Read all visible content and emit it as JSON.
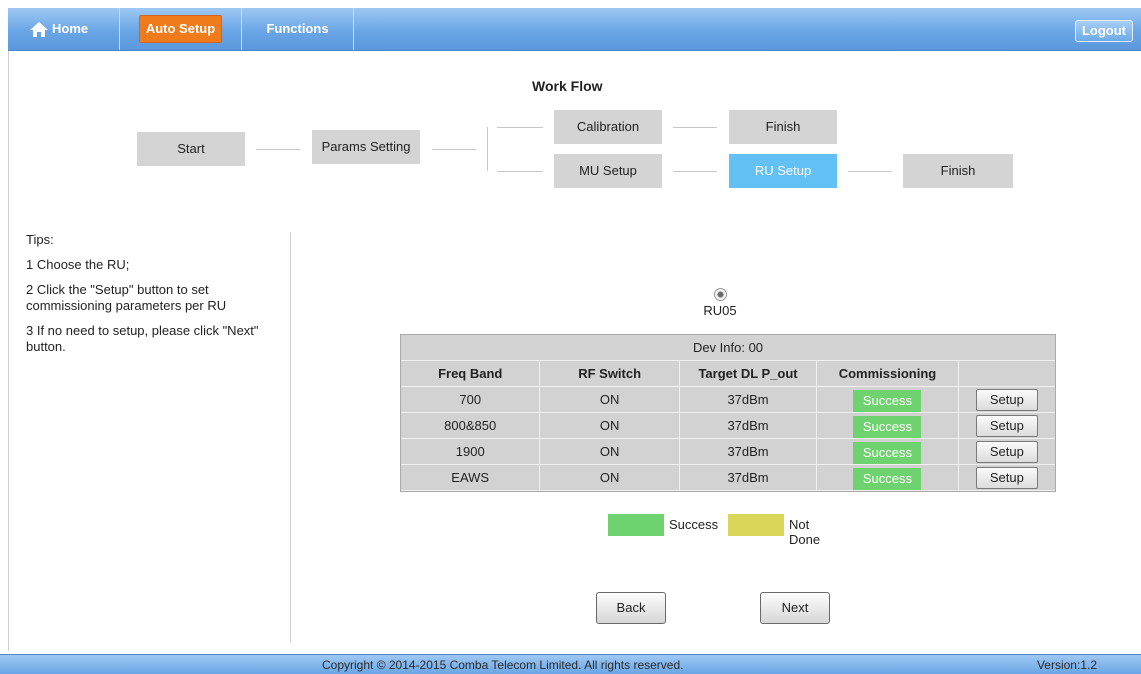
{
  "nav": {
    "home": "Home",
    "auto_setup": "Auto Setup",
    "functions": "Functions",
    "logout": "Logout"
  },
  "workflow": {
    "title": "Work Flow",
    "start": "Start",
    "params": "Params Setting",
    "calibration": "Calibration",
    "finish_top": "Finish",
    "mu_setup": "MU Setup",
    "ru_setup": "RU Setup",
    "finish_bottom": "Finish"
  },
  "tips": {
    "heading": "Tips:",
    "items": [
      "1 Choose the RU;",
      "2 Click the \"Setup\" button to set commissioning parameters per RU",
      "3 If no need to setup, please click \"Next\" button."
    ]
  },
  "ru": {
    "label": "RU05"
  },
  "table": {
    "dev_info": "Dev Info: 00",
    "headers": [
      "Freq Band",
      "RF Switch",
      "Target DL P_out",
      "Commissioning",
      ""
    ],
    "rows": [
      {
        "band": "700",
        "rf": "ON",
        "pout": "37dBm",
        "status": "Success",
        "action": "Setup"
      },
      {
        "band": "800&850",
        "rf": "ON",
        "pout": "37dBm",
        "status": "Success",
        "action": "Setup"
      },
      {
        "band": "1900",
        "rf": "ON",
        "pout": "37dBm",
        "status": "Success",
        "action": "Setup"
      },
      {
        "band": "EAWS",
        "rf": "ON",
        "pout": "37dBm",
        "status": "Success",
        "action": "Setup"
      }
    ]
  },
  "legend": {
    "success": "Success",
    "not_done": "Not Done",
    "success_color": "#6ed36e",
    "not_done_color": "#d9d65a"
  },
  "buttons": {
    "back": "Back",
    "next": "Next"
  },
  "footer": {
    "copyright": "Copyright © 2014-2015 Comba Telecom Limited. All rights reserved.",
    "version": "Version:1.2"
  },
  "colors": {
    "nav_bar": "#6aa6e6",
    "active_tab": "#f07b1a",
    "active_step": "#62c0f5",
    "step": "#d4d4d4"
  },
  "icons": {
    "home": "home-icon"
  }
}
